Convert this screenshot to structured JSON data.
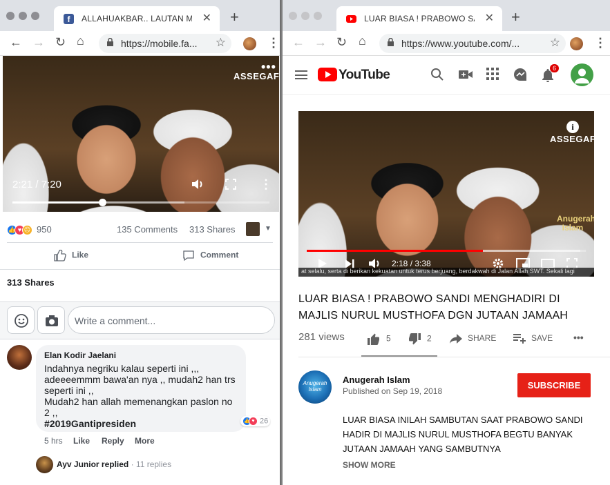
{
  "left": {
    "tab_title": "ALLAHUAKBAR.. LAUTAN MA",
    "tab_close": "✕",
    "new_tab": "+",
    "url": "https://mobile.fa...",
    "video": {
      "time": "2:21 / 7:20",
      "progress": 0.35,
      "buffered": 0.67,
      "watermark": "ASSEGAF"
    },
    "reactions_count": "950",
    "comments": "135 Comments",
    "shares": "313 Shares",
    "like_label": "Like",
    "comment_label": "Comment",
    "shares_heading": "313 Shares",
    "comment_placeholder": "Write a comment...",
    "comment": {
      "author": "Elan Kodir Jaelani",
      "text": "Indahnya negriku kalau seperti ini ,,,\nadeeeemmm bawa'an nya ,, mudah2 han trs\nseperti ini ,,\nMudah2 han allah memenangkan paslon no\n2 ,,",
      "hashtag": "#2019Gantipresiden",
      "reaction_count": "26",
      "time": "5 hrs",
      "like": "Like",
      "reply": "Reply",
      "more": "More"
    },
    "reply_author": "Ayv Junior replied",
    "reply_count": "· 11 replies"
  },
  "right": {
    "tab_title": "LUAR BIASA ! PRABOWO SAND",
    "tab_close": "✕",
    "new_tab": "+",
    "url": "https://www.youtube.com/...",
    "brand": "YouTube",
    "notif_count": "6",
    "video": {
      "time": "2:18 / 3:38",
      "progress": 0.63,
      "buffered": 0.98,
      "watermark": "ASSEGAF",
      "overlay_logo": "Anugerah Islam",
      "caption": "at selalu, serta di berikan kekuatan untuk terus  berjuang, berdakwah di Jalan Allah SWT.  Sekali lagi"
    },
    "title": "LUAR BIASA ! PRABOWO SANDI MENGHADIRI DI MAJLIS NURUL MUSTHOFA DGN JUTAAN JAMAAH",
    "views": "281 views",
    "likes": "5",
    "dislikes": "2",
    "share": "SHARE",
    "save": "SAVE",
    "channel": "Anugerah Islam",
    "published": "Published on Sep 19, 2018",
    "subscribe": "SUBSCRIBE",
    "description": "LUAR BIASA INILAH SAMBUTAN  SAAT PRABOWO SANDI\nHADIR DI MAJLIS NURUL MUSTHOFA  BEGTU BANYAK\nJUTAAN JAMAAH YANG SAMBUTNYA",
    "show_more": "SHOW MORE"
  },
  "colors": {
    "fb_blue": "#4267b2",
    "yt_red": "#ff0000",
    "subscribe": "#e62117"
  }
}
